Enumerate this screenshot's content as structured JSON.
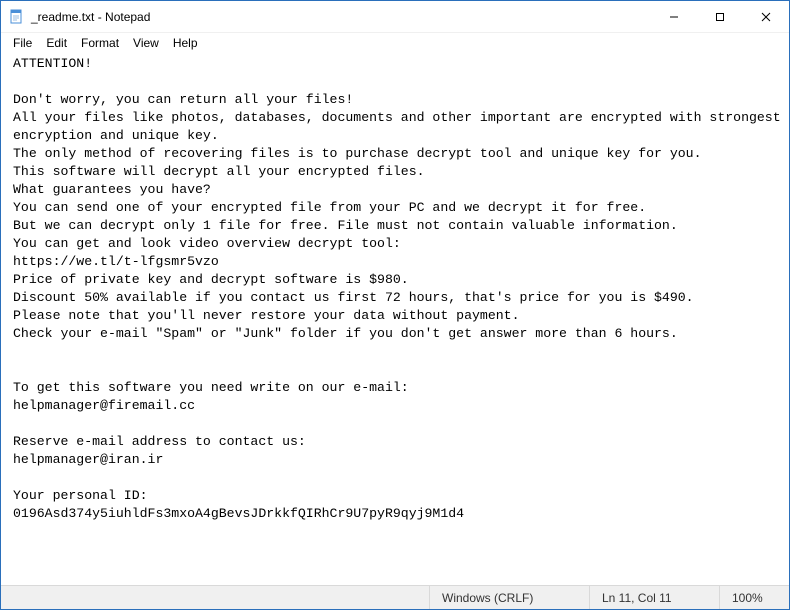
{
  "window": {
    "title": "_readme.txt - Notepad",
    "icon": "notepad-icon",
    "controls": {
      "minimize": "–",
      "maximize": "☐",
      "close": "✕"
    }
  },
  "menu": {
    "file": "File",
    "edit": "Edit",
    "format": "Format",
    "view": "View",
    "help": "Help"
  },
  "document": {
    "lines": [
      "ATTENTION!",
      "",
      "Don't worry, you can return all your files!",
      "All your files like photos, databases, documents and other important are encrypted with strongest encryption and unique key.",
      "The only method of recovering files is to purchase decrypt tool and unique key for you.",
      "This software will decrypt all your encrypted files.",
      "What guarantees you have?",
      "You can send one of your encrypted file from your PC and we decrypt it for free.",
      "But we can decrypt only 1 file for free. File must not contain valuable information.",
      "You can get and look video overview decrypt tool:",
      "https://we.tl/t-lfgsmr5vzo",
      "Price of private key and decrypt software is $980.",
      "Discount 50% available if you contact us first 72 hours, that's price for you is $490.",
      "Please note that you'll never restore your data without payment.",
      "Check your e-mail \"Spam\" or \"Junk\" folder if you don't get answer more than 6 hours.",
      "",
      "",
      "To get this software you need write on our e-mail:",
      "helpmanager@firemail.cc",
      "",
      "Reserve e-mail address to contact us:",
      "helpmanager@iran.ir",
      "",
      "Your personal ID:",
      "0196Asd374y5iuhldFs3mxoA4gBevsJDrkkfQIRhCr9U7pyR9qyj9M1d4"
    ]
  },
  "status": {
    "line_ending": "Windows (CRLF)",
    "cursor": "Ln 11, Col 11",
    "zoom": "100%"
  }
}
